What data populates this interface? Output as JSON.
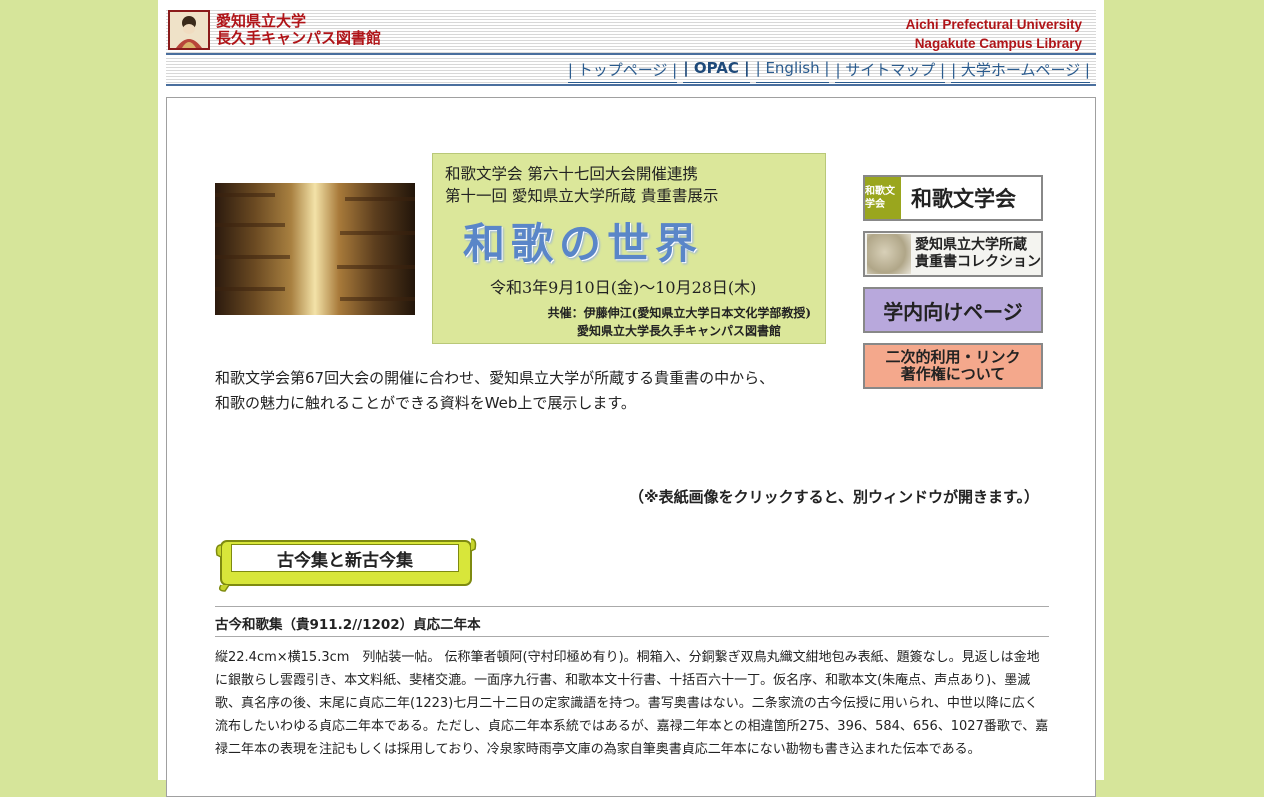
{
  "header": {
    "logo_jp_line1": "愛知県立大学",
    "logo_jp_line2": "長久手キャンパス図書館",
    "logo_en_line1": "Aichi Prefectural University",
    "logo_en_line2": "Nagakute Campus Library"
  },
  "nav": [
    {
      "label": "| トップページ |"
    },
    {
      "label": "| OPAC |"
    },
    {
      "label": "| English |"
    },
    {
      "label": "| サイトマップ |"
    },
    {
      "label": "| 大学ホームページ |"
    }
  ],
  "banner": {
    "line1": "和歌文学会 第六十七回大会開催連携",
    "line2": "第十一回 愛知県立大学所蔵 貴重書展示",
    "title": "和歌の世界",
    "date": "令和3年9月10日(金)〜10月28日(木)",
    "co1": "共催：伊藤伸江(愛知県立大学日本文化学部教授)",
    "co2": "愛知県立大学長久手キャンパス図書館"
  },
  "side": {
    "btn1_tag": "和歌文学会",
    "btn1_label": "和歌文学会",
    "btn2_line1": "愛知県立大学所蔵",
    "btn2_line2": "貴重書コレクション",
    "btn3_label": "学内向けページ",
    "btn4_line1": "二次的利用・リンク",
    "btn4_line2": "著作権について"
  },
  "intro": {
    "line1": "和歌文学会第67回大会の開催に合わせ、愛知県立大学が所蔵する貴重書の中から、",
    "line2": "和歌の魅力に触れることができる資料をWeb上で展示します。"
  },
  "note": "（※表紙画像をクリックすると、別ウィンドウが開きます。）",
  "section": {
    "heading": "古今集と新古今集",
    "item_title": "古今和歌集（貴911.2//1202）貞応二年本",
    "item_desc": "縦22.4cm×横15.3cm　列帖装一帖。 伝称筆者頓阿(守村印極め有り)。桐箱入、分銅繋ぎ双鳥丸織文紺地包み表紙、題簽なし。見返しは金地に銀散らし雲霞引き、本文料紙、斐楮交漉。一面序九行書、和歌本文十行書、十括百六十一丁。仮名序、和歌本文(朱庵点、声点あり)、墨滅歌、真名序の後、末尾に貞応二年(1223)七月二十二日の定家識語を持つ。書写奥書はない。二条家流の古今伝授に用いられ、中世以降に広く流布したいわゆる貞応二年本である。ただし、貞応二年本系統ではあるが、嘉禄二年本との相違箇所275、396、584、656、1027番歌で、嘉禄二年本の表現を注記もしくは採用しており、冷泉家時雨亭文庫の為家自筆奥書貞応二年本にない勘物も書き込まれた伝本である。"
  }
}
